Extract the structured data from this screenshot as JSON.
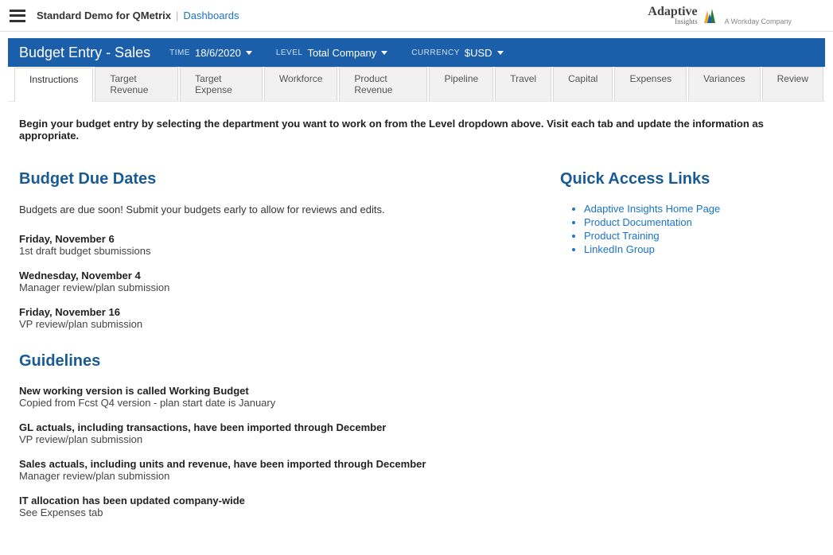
{
  "header": {
    "demo_label": "Standard Demo for QMetrix",
    "breadcrumb": "Dashboards",
    "logo_main": "Adaptive",
    "logo_sub": "Insights",
    "logo_tagline": "A Workday Company"
  },
  "bluebar": {
    "title": "Budget Entry - Sales",
    "time_label": "TIME",
    "time_value": "18/6/2020",
    "level_label": "LEVEL",
    "level_value": "Total Company",
    "currency_label": "CURRENCY",
    "currency_value": "$USD"
  },
  "tabs": [
    "Instructions",
    "Target Revenue",
    "Target Expense",
    "Workforce",
    "Product Revenue",
    "Pipeline",
    "Travel",
    "Capital",
    "Expenses",
    "Variances",
    "Review"
  ],
  "intro": "Begin your budget entry by selecting the department you want to work on from the Level dropdown above.  Visit each tab and update the information as appropriate.",
  "budget_dates": {
    "heading": "Budget Due Dates",
    "intro": "Budgets are due soon! Submit your budgets early to allow for reviews and edits.",
    "items": [
      {
        "date": "Friday, November 6",
        "desc": "1st draft budget sbumissions"
      },
      {
        "date": "Wednesday, November 4",
        "desc": "Manager review/plan submission"
      },
      {
        "date": "Friday, November 16",
        "desc": "VP review/plan submission"
      }
    ]
  },
  "guidelines": {
    "heading": "Guidelines",
    "items": [
      {
        "title": "New working version is called Working Budget",
        "desc": "Copied from Fcst Q4 version - plan start date is January"
      },
      {
        "title": "GL actuals, including transactions, have been imported through December",
        "desc": "VP review/plan submission"
      },
      {
        "title": "Sales actuals, including units and revenue, have been imported through December",
        "desc": "Manager review/plan submission"
      },
      {
        "title": "IT allocation has been updated company-wide",
        "desc": "See Expenses tab"
      }
    ]
  },
  "quicklinks": {
    "heading": "Quick Access Links",
    "items": [
      "Adaptive Insights Home Page",
      "Product Documentation",
      "Product Training",
      "LinkedIn Group"
    ]
  }
}
